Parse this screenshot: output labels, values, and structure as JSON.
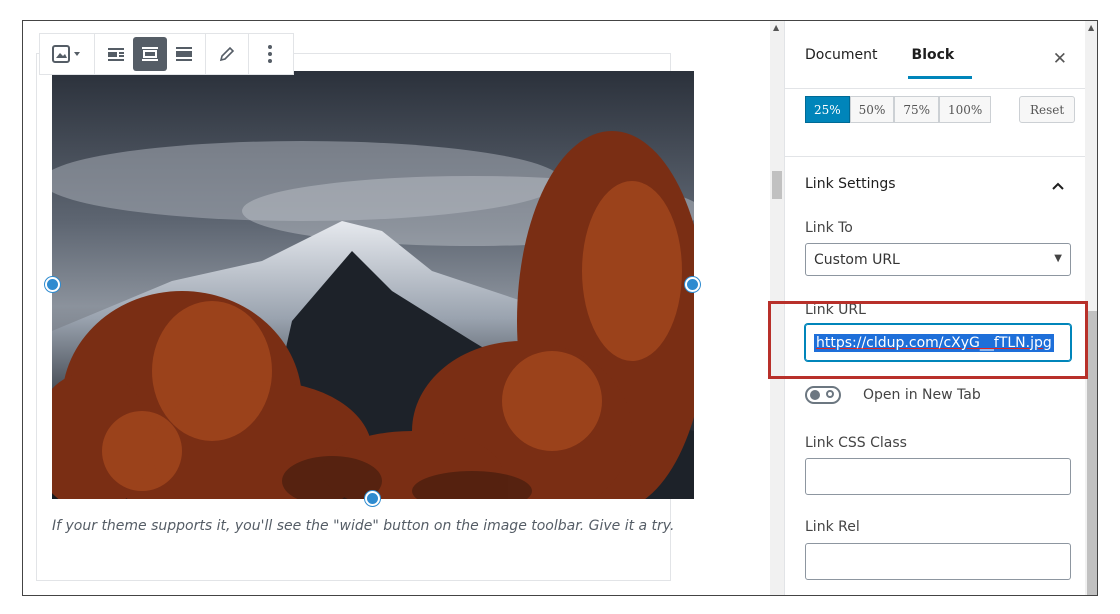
{
  "toolbar": {
    "buttons": [
      "image-icon",
      "chevron-down-icon",
      "align-left-icon",
      "align-center-icon",
      "align-wide-icon",
      "edit-icon",
      "more-vertical-icon"
    ]
  },
  "editor": {
    "caption": "If your theme supports it, you'll see the \"wide\" button on the image toolbar. Give it a try."
  },
  "sidebar": {
    "tabs": [
      "Document",
      "Block"
    ],
    "active_tab": "Block",
    "close": "✕",
    "sizes": [
      "25%",
      "50%",
      "75%",
      "100%"
    ],
    "active_size": "25%",
    "reset": "Reset",
    "panel_title": "Link Settings",
    "link_to_label": "Link To",
    "link_to_value": "Custom URL",
    "link_url_label": "Link URL",
    "link_url_value": "https://cldup.com/cXyG__fTLN.jpg",
    "new_tab_label": "Open in New Tab",
    "css_class_label": "Link CSS Class",
    "rel_label": "Link Rel"
  },
  "colors": {
    "accent": "#0085ba",
    "handle": "#2e8bd0",
    "highlight": "#b8302a"
  }
}
